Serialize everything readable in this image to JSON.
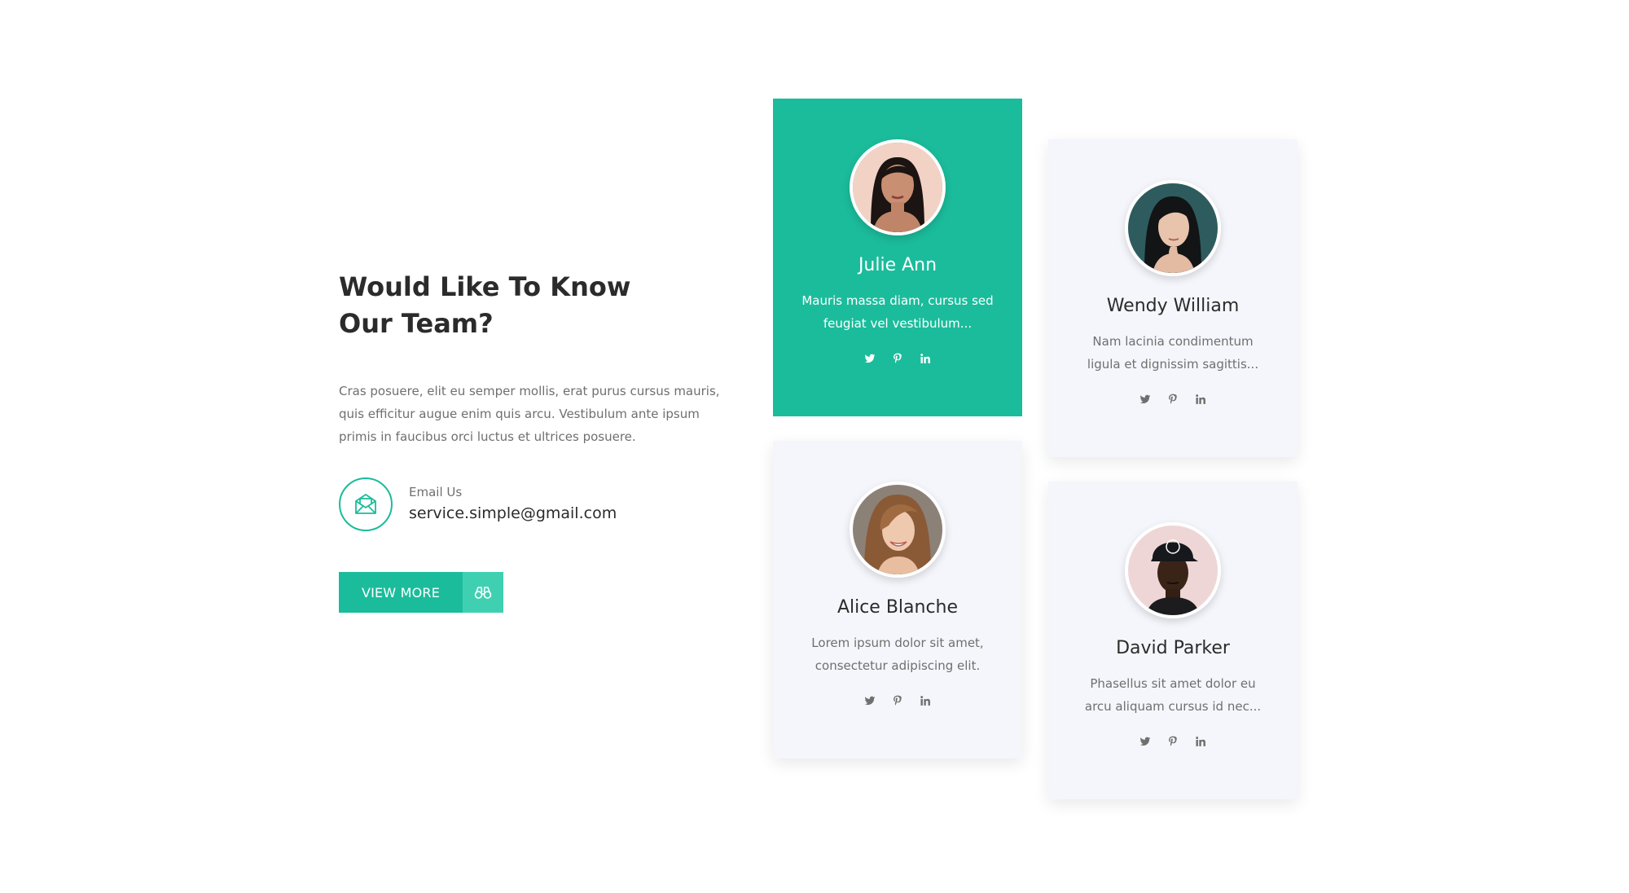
{
  "intro": {
    "heading_line1": "Would Like To Know",
    "heading_line2": "Our Team",
    "heading_qmark": "?",
    "text": "Cras posuere, elit eu semper mollis, erat purus cursus mauris, quis efficitur augue enim quis arcu. Vestibulum ante ipsum primis in faucibus orci luctus et ultrices posuere.",
    "email_label": "Email Us",
    "email_address": "service.simple@gmail.com",
    "button_label": "VIEW MORE",
    "button_icon": "binoculars-icon",
    "email_icon": "envelope-icon"
  },
  "colors": {
    "accent": "#1bbc9b",
    "accent_light": "#3fd0b2",
    "card_bg": "#f5f6fb",
    "text_dark": "#2b2b2b",
    "text_muted": "#6f6f6f"
  },
  "team": [
    {
      "name": "Julie Ann",
      "description": "Mauris massa diam, cursus sed feugiat vel vestibulum...",
      "active": true,
      "socials": [
        "twitter-icon",
        "pinterest-icon",
        "linkedin-icon"
      ]
    },
    {
      "name": "Wendy William",
      "description": "Nam lacinia condimentum ligula et dignissim sagittis...",
      "active": false,
      "socials": [
        "twitter-icon",
        "pinterest-icon",
        "linkedin-icon"
      ]
    },
    {
      "name": "Alice Blanche",
      "description": "Lorem ipsum dolor sit amet, consectetur adipiscing elit.",
      "active": false,
      "socials": [
        "twitter-icon",
        "pinterest-icon",
        "linkedin-icon"
      ]
    },
    {
      "name": "David Parker",
      "description": "Phasellus sit amet dolor eu arcu aliquam cursus id nec...",
      "active": false,
      "socials": [
        "twitter-icon",
        "pinterest-icon",
        "linkedin-icon"
      ]
    }
  ]
}
